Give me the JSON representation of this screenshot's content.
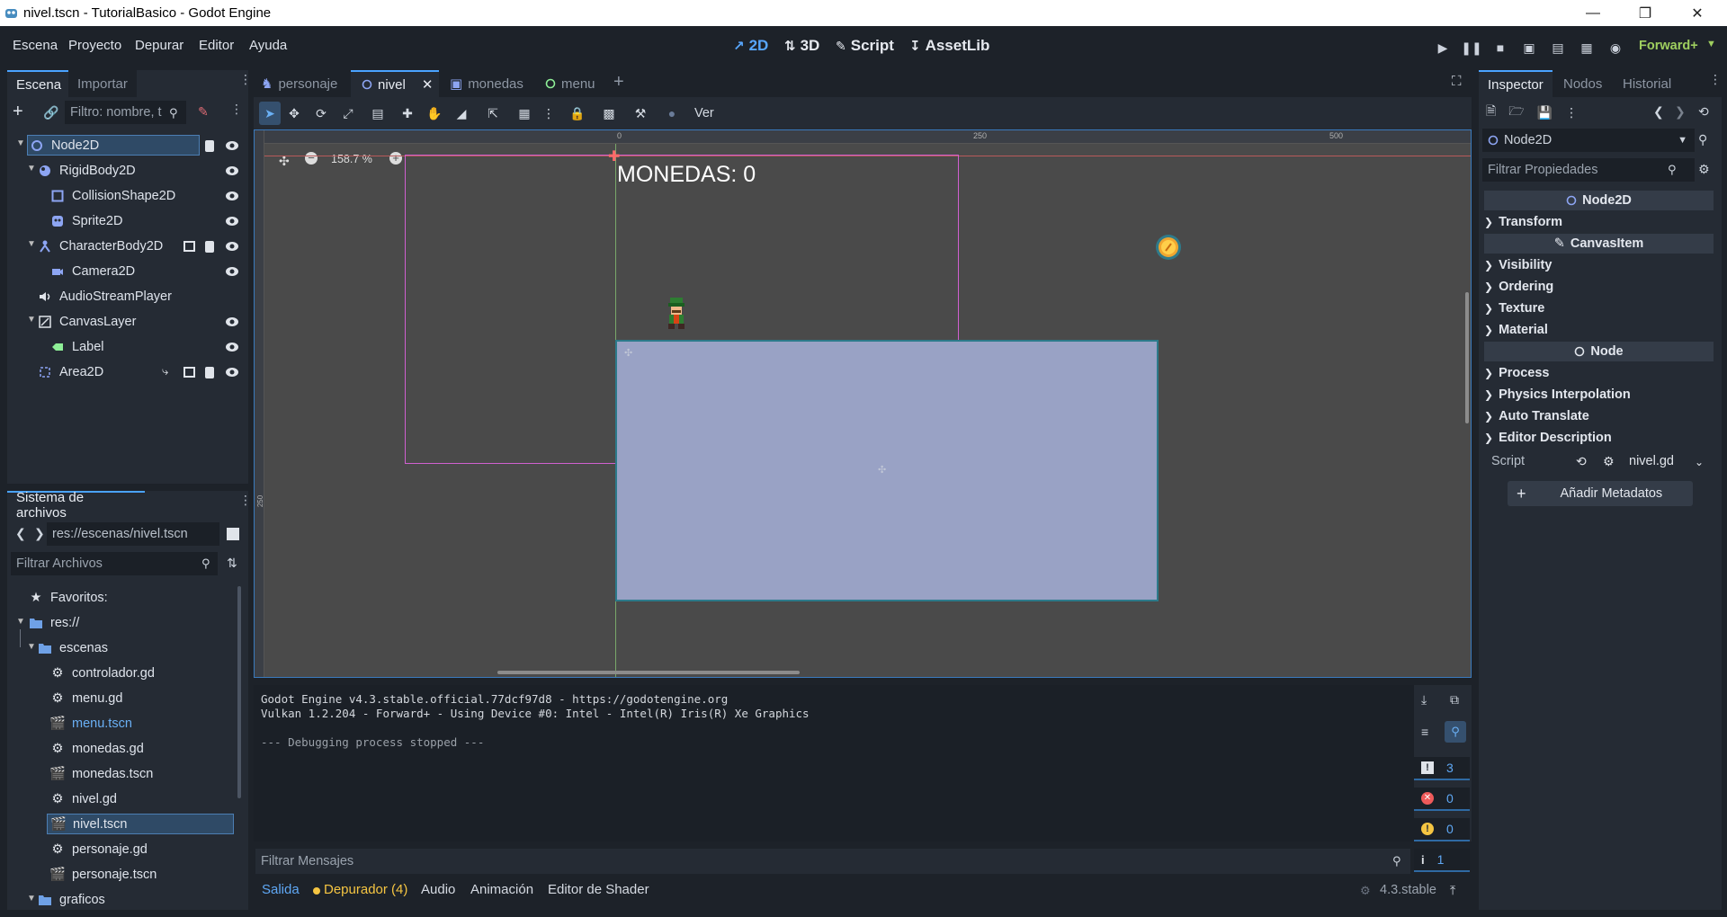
{
  "window": {
    "title": "nivel.tscn - TutorialBasico - Godot Engine"
  },
  "menu": [
    "Escena",
    "Proyecto",
    "Depurar",
    "Editor",
    "Ayuda"
  ],
  "workspaces": [
    {
      "label": "2D",
      "active": true
    },
    {
      "label": "3D",
      "active": false
    },
    {
      "label": "Script",
      "active": false
    },
    {
      "label": "AssetLib",
      "active": false
    }
  ],
  "renderer": "Forward+",
  "scene_panel": {
    "tabs": [
      "Escena",
      "Importar"
    ],
    "filter_placeholder": "Filtro: nombre, t",
    "nodes": [
      {
        "label": "Node2D",
        "icon": "node2d-icon"
      },
      {
        "label": "RigidBody2D",
        "icon": "rigidbody-icon"
      },
      {
        "label": "CollisionShape2D",
        "icon": "collision-shape-icon"
      },
      {
        "label": "Sprite2D",
        "icon": "sprite-icon"
      },
      {
        "label": "CharacterBody2D",
        "icon": "character-body-icon"
      },
      {
        "label": "Camera2D",
        "icon": "camera-icon"
      },
      {
        "label": "AudioStreamPlayer",
        "icon": "audio-icon"
      },
      {
        "label": "CanvasLayer",
        "icon": "canvas-layer-icon"
      },
      {
        "label": "Label",
        "icon": "label-icon"
      },
      {
        "label": "Area2D",
        "icon": "area-icon"
      }
    ]
  },
  "filesystem": {
    "title": "Sistema de archivos",
    "path": "res://escenas/nivel.tscn",
    "filter_placeholder": "Filtrar Archivos",
    "items": [
      {
        "label": "Favoritos:",
        "icon": "star-icon"
      },
      {
        "label": "res://",
        "icon": "folder-icon"
      },
      {
        "label": "escenas",
        "icon": "folder-icon"
      },
      {
        "label": "controlador.gd",
        "icon": "gear-icon"
      },
      {
        "label": "menu.gd",
        "icon": "gear-icon"
      },
      {
        "label": "menu.tscn",
        "icon": "scene-icon"
      },
      {
        "label": "monedas.gd",
        "icon": "gear-icon"
      },
      {
        "label": "monedas.tscn",
        "icon": "scene-icon"
      },
      {
        "label": "nivel.gd",
        "icon": "gear-icon"
      },
      {
        "label": "nivel.tscn",
        "icon": "scene-icon"
      },
      {
        "label": "personaje.gd",
        "icon": "gear-icon"
      },
      {
        "label": "personaje.tscn",
        "icon": "scene-icon"
      },
      {
        "label": "graficos",
        "icon": "folder-icon"
      }
    ]
  },
  "scene_tabs": [
    "personaje",
    "nivel",
    "monedas",
    "menu"
  ],
  "toolbar": {
    "view_label": "Ver"
  },
  "viewport": {
    "zoom": "158.7 %",
    "ruler_labels": [
      "0",
      "250",
      "500"
    ],
    "ruler_vertical_label": "250",
    "hud_text": "MONEDAS: 0"
  },
  "console": {
    "lines": [
      "Godot Engine v4.3.stable.official.77dcf97d8 - https://godotengine.org",
      "Vulkan 1.2.204 - Forward+ - Using Device #0: Intel - Intel(R) Iris(R) Xe Graphics",
      "",
      "--- Debugging process stopped ---"
    ],
    "filter_placeholder": "Filtrar Mensajes",
    "counters": [
      "3",
      "0",
      "0",
      "1"
    ]
  },
  "bottom_tabs": [
    "Salida",
    "Depurador (4)",
    "Audio",
    "Animación",
    "Editor de Shader"
  ],
  "version": "4.3.stable",
  "inspector": {
    "tabs": [
      "Inspector",
      "Nodos",
      "Historial"
    ],
    "node": "Node2D",
    "filter_placeholder": "Filtrar Propiedades",
    "class_node2d": "Node2D",
    "sections_a": [
      "Transform"
    ],
    "class_canvas": "CanvasItem",
    "sections_b": [
      "Visibility",
      "Ordering",
      "Texture",
      "Material"
    ],
    "class_node": "Node",
    "sections_c": [
      "Process",
      "Physics Interpolation",
      "Auto Translate",
      "Editor Description"
    ],
    "script_label": "Script",
    "script_value": "nivel.gd",
    "add_metadata": "Añadir Metadatos"
  },
  "colors": {
    "accent": "#4aa3ff",
    "selection": "#2f4a66",
    "viewport_bg": "#4a4a4a",
    "rect_fill": "#99a2c5",
    "camera_rect": "#d060d0"
  }
}
